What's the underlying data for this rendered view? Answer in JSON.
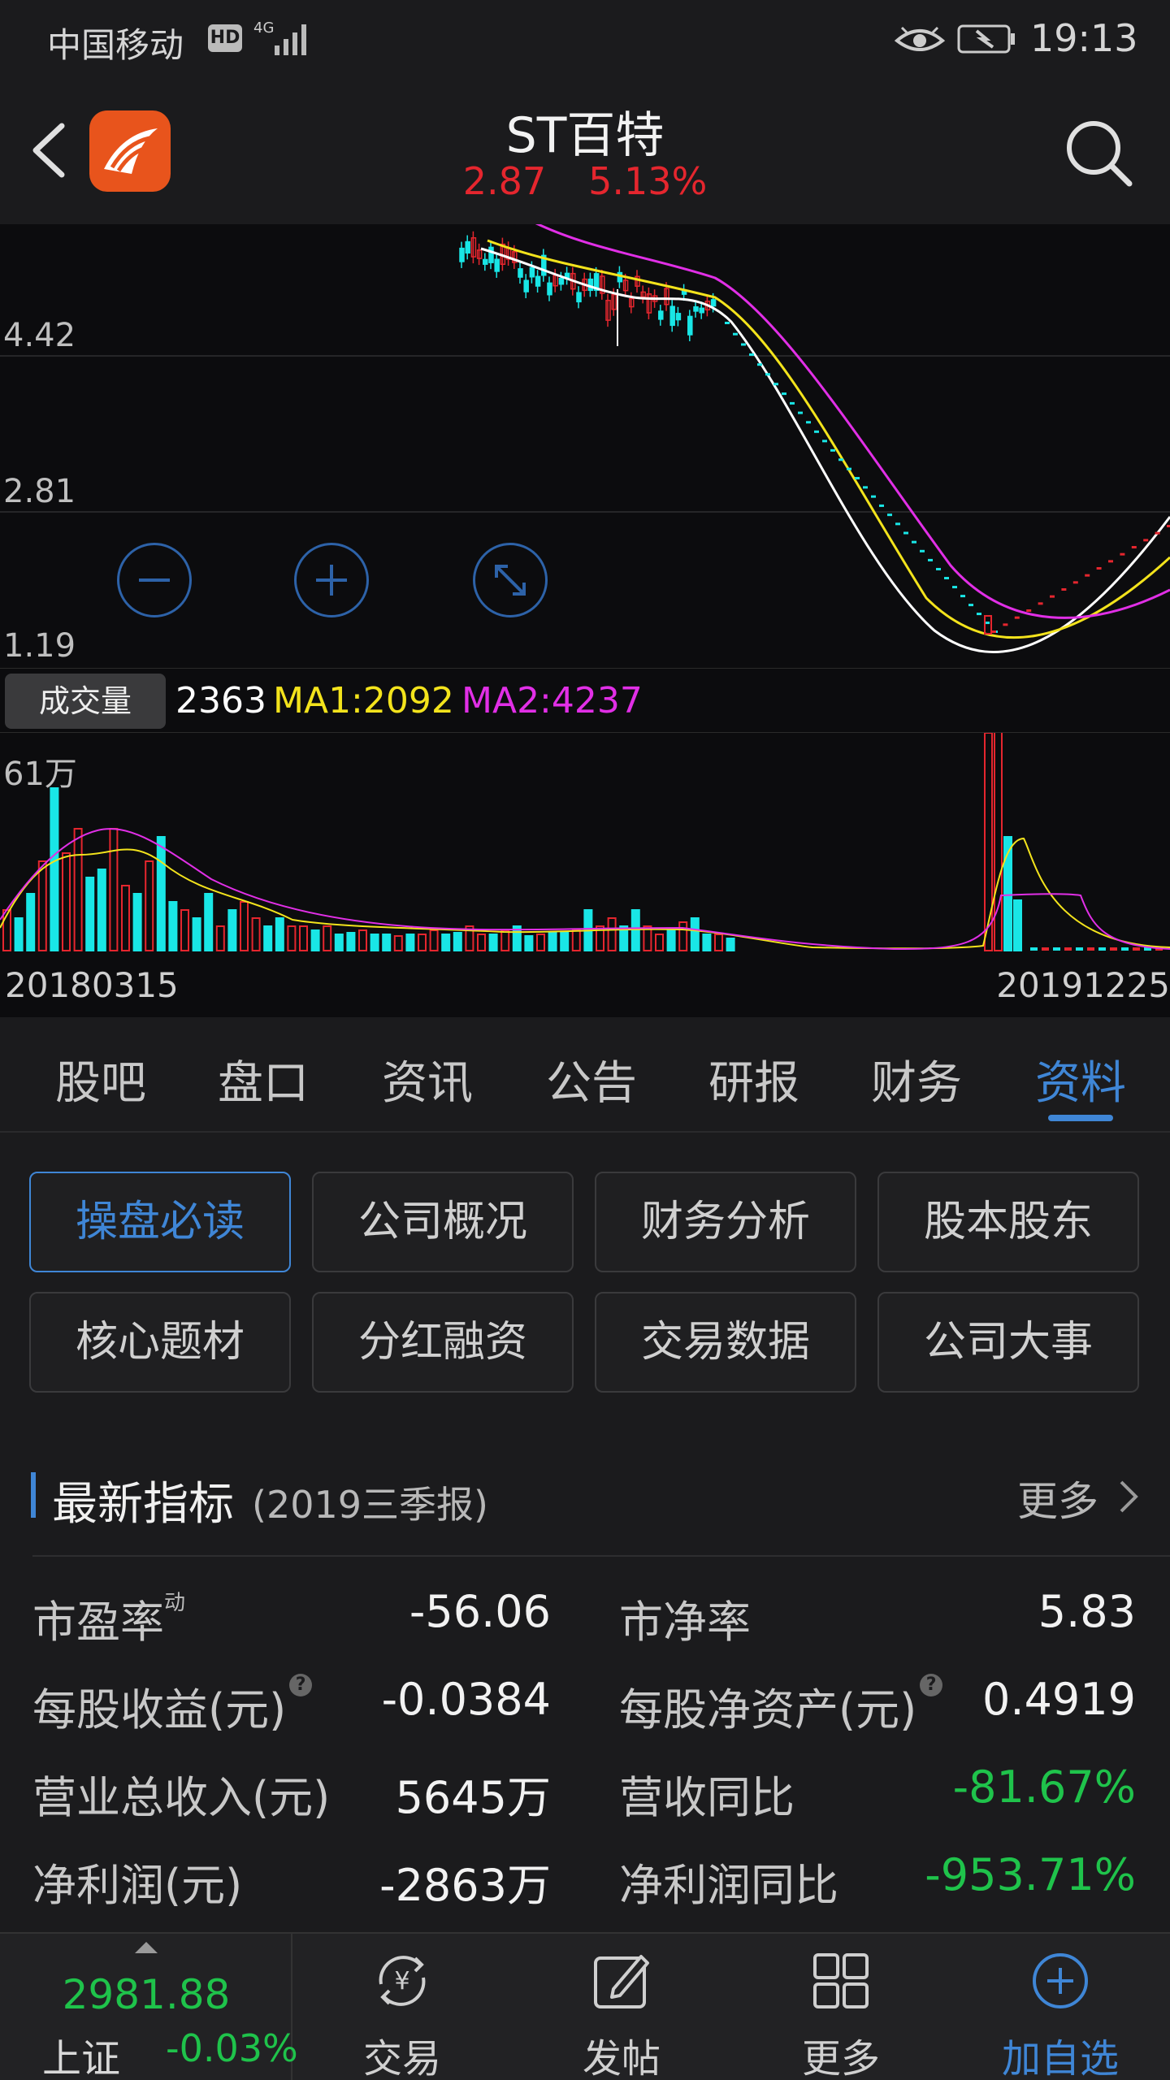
{
  "status_bar": {
    "carrier": "中国移动",
    "hd": "HD",
    "network": "4G",
    "time": "19:13"
  },
  "header": {
    "stock_name": "ST百特",
    "price": "2.87",
    "change_pct": "5.13%"
  },
  "kline": {
    "price_labels": [
      "4.42",
      "2.81",
      "1.19"
    ]
  },
  "volume": {
    "tag": "成交量",
    "value": "2363",
    "ma1": "MA1:2092",
    "ma2": "MA2:4237",
    "max_label": "61万",
    "start_date": "20180315",
    "end_date": "20191225"
  },
  "tabs": [
    {
      "label": "股吧"
    },
    {
      "label": "盘口"
    },
    {
      "label": "资讯"
    },
    {
      "label": "公告"
    },
    {
      "label": "研报"
    },
    {
      "label": "财务"
    },
    {
      "label": "资料"
    }
  ],
  "sections": [
    {
      "label": "操盘必读"
    },
    {
      "label": "公司概况"
    },
    {
      "label": "财务分析"
    },
    {
      "label": "股本股东"
    },
    {
      "label": "核心题材"
    },
    {
      "label": "分红融资"
    },
    {
      "label": "交易数据"
    },
    {
      "label": "公司大事"
    }
  ],
  "indicators": {
    "title": "最新指标",
    "subtitle": "(2019三季报)",
    "more": "更多",
    "rows": [
      {
        "label_left": "市盈率",
        "sup_left": "动",
        "value_left": "-56.06",
        "label_right": "市净率",
        "value_right": "5.83"
      },
      {
        "label_left": "每股收益(元)",
        "value_left": "-0.0384",
        "label_right": "每股净资产(元)",
        "value_right": "0.4919"
      },
      {
        "label_left": "营业总收入(元)",
        "value_left": "5645万",
        "label_right": "营收同比",
        "value_right": "-81.67%"
      },
      {
        "label_left": "净利润(元)",
        "value_left": "-2863万",
        "label_right": "净利润同比",
        "value_right": "-953.71%"
      }
    ]
  },
  "bottom_bar": {
    "index_value": "2981.88",
    "index_name": "上证",
    "index_change": "-0.03%",
    "nav": [
      {
        "label": "交易",
        "icon": "yuan-cycle-icon"
      },
      {
        "label": "发帖",
        "icon": "edit-icon"
      },
      {
        "label": "更多",
        "icon": "grid-icon"
      },
      {
        "label": "加自选",
        "icon": "plus-circle-icon"
      }
    ]
  },
  "colors": {
    "up": "#e5262e",
    "down": "#1fc34b",
    "accent": "#3f86d6",
    "ma_white": "#ffffff",
    "ma_yellow": "#f3e31c",
    "ma_magenta": "#e12fe6",
    "candle_down": "#19e6e6"
  }
}
